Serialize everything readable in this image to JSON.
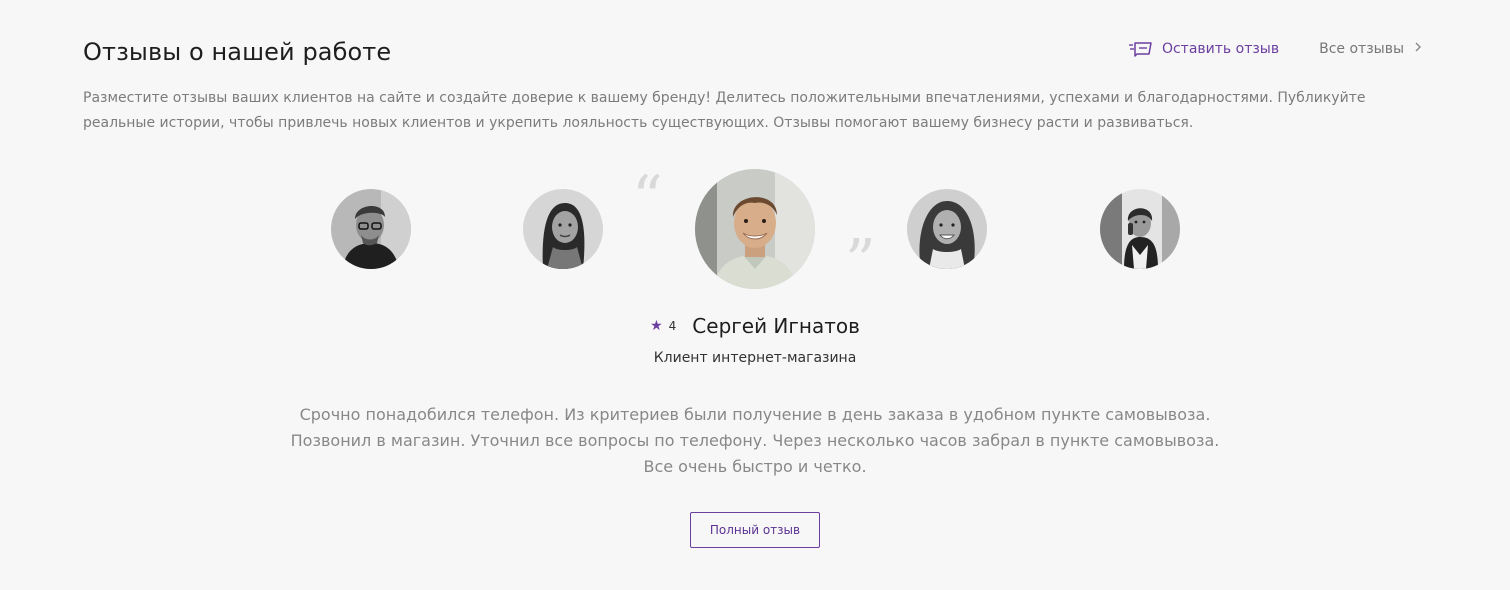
{
  "header": {
    "title": "Отзывы о нашей работе",
    "leave_review": "Оставить отзыв",
    "all_reviews": "Все отзывы",
    "description": "Разместите отзывы ваших клиентов на сайте и создайте доверие к вашему бренду! Делитесь положительными впечатлениями, успехами и благодарностями. Публикуйте реальные истории, чтобы привлечь новых клиентов и укрепить лояльность существующих. Отзывы помогают вашему бизнесу расти и развиваться."
  },
  "active_review": {
    "rating": "4",
    "name": "Сергей Игнатов",
    "role": "Клиент интернет-магазина",
    "text_lines": [
      "Срочно понадобился телефон. Из критериев были получение в день заказа в удобном пункте самовывоза.",
      "Позвонил в магазин. Уточнил все вопросы по телефону. Через несколько часов забрал в пункте самовывоза.",
      "Все очень быстро и четко."
    ],
    "button_label": "Полный отзыв"
  },
  "icons": {
    "leave_review": "message-edit-icon",
    "all_reviews": "chevron-right-icon",
    "rating": "star-icon",
    "quote_open": "quote-open-icon",
    "quote_close": "quote-close-icon"
  },
  "colors": {
    "accent": "#6b3fa0",
    "background": "#f7f7f7",
    "muted_text": "#7c7c7c"
  }
}
